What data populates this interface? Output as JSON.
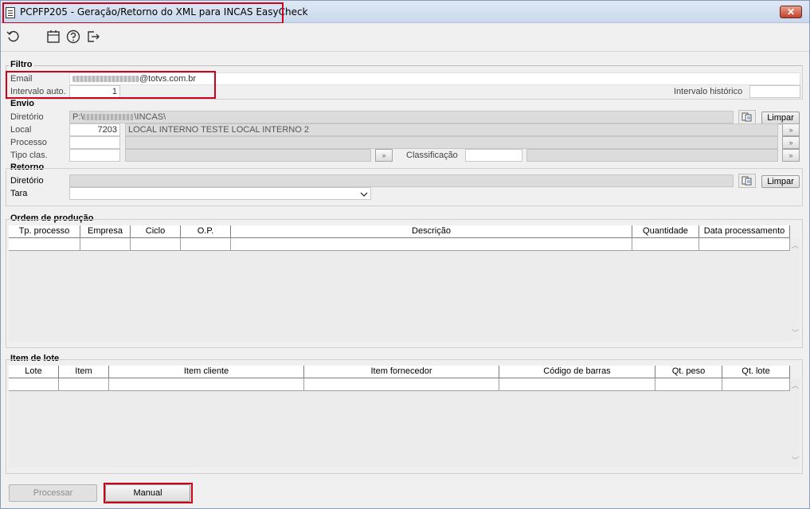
{
  "window": {
    "title": "PCPFP205 - Geração/Retorno do XML para INCAS EasyCheck",
    "close_label": "✕"
  },
  "toolbar": {
    "icons": [
      "refresh-icon",
      "calendar-icon",
      "help-icon",
      "exit-icon"
    ]
  },
  "filtro": {
    "group_label": "Filtro",
    "email_label": "Email",
    "email_suffix": "@totvs.com.br",
    "intervalo_auto_label": "Intervalo auto.",
    "intervalo_auto_value": "1",
    "intervalo_historico_label": "Intervalo histórico",
    "intervalo_historico_value": ""
  },
  "envio": {
    "group_label": "Envio",
    "diretorio_label": "Diretório",
    "diretorio_prefix": "P:\\",
    "diretorio_suffix": "\\INCAS\\",
    "limpar_label": "Limpar",
    "local_label": "Local",
    "local_code": "7203",
    "local_desc": "LOCAL INTERNO TESTE LOCAL INTERNO 2",
    "processo_label": "Processo",
    "tipo_clas_label": "Tipo clas.",
    "classificacao_label": "Classificação"
  },
  "retorno": {
    "group_label": "Retorno",
    "diretorio_label": "Diretório",
    "limpar_label": "Limpar",
    "tara_label": "Tara",
    "tara_value": ""
  },
  "ordem_producao": {
    "group_label": "Ordem de produção",
    "columns": [
      "Tp. processo",
      "Empresa",
      "Ciclo",
      "O.P.",
      "Descrição",
      "Quantidade",
      "Data processamento"
    ]
  },
  "item_lote": {
    "group_label": "Item de lote",
    "columns": [
      "Lote",
      "Item",
      "Item cliente",
      "Item fornecedor",
      "Código de barras",
      "Qt. peso",
      "Qt. lote"
    ]
  },
  "footer": {
    "processar_label": "Processar",
    "manual_label": "Manual"
  },
  "colors": {
    "highlight": "#d0021b",
    "window_bg": "#f0f0f0",
    "readonly_field": "#dcdcdc"
  }
}
